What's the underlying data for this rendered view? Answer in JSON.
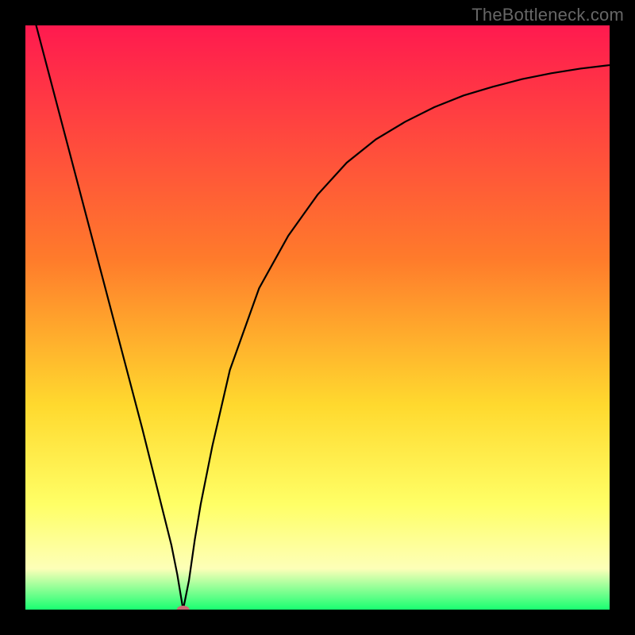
{
  "watermark": "TheBottleneck.com",
  "chart_data": {
    "type": "line",
    "title": "",
    "xlabel": "",
    "ylabel": "",
    "xlim": [
      0,
      100
    ],
    "ylim": [
      0,
      100
    ],
    "grid": false,
    "background_gradient": {
      "type": "vertical",
      "stops": [
        {
          "pos": 0,
          "color": "#ff1a4f"
        },
        {
          "pos": 40,
          "color": "#ff7b2b"
        },
        {
          "pos": 65,
          "color": "#ffd92e"
        },
        {
          "pos": 82,
          "color": "#ffff66"
        },
        {
          "pos": 93,
          "color": "#fdffb8"
        },
        {
          "pos": 100,
          "color": "#19ff71"
        }
      ]
    },
    "marker": {
      "x": 27,
      "y": 0,
      "color": "#cc6a76",
      "rx": 8,
      "ry": 5
    },
    "series": [
      {
        "name": "curve",
        "x": [
          0,
          5,
          10,
          15,
          20,
          23,
          25,
          26,
          27,
          28,
          29,
          30,
          32,
          35,
          40,
          45,
          50,
          55,
          60,
          65,
          70,
          75,
          80,
          85,
          90,
          95,
          100
        ],
        "values": [
          107,
          88,
          69,
          50,
          31,
          19,
          11,
          6,
          0,
          5,
          12,
          18,
          28,
          41,
          55,
          64,
          71,
          76.5,
          80.5,
          83.5,
          86,
          88,
          89.5,
          90.8,
          91.8,
          92.6,
          93.2
        ]
      }
    ]
  }
}
